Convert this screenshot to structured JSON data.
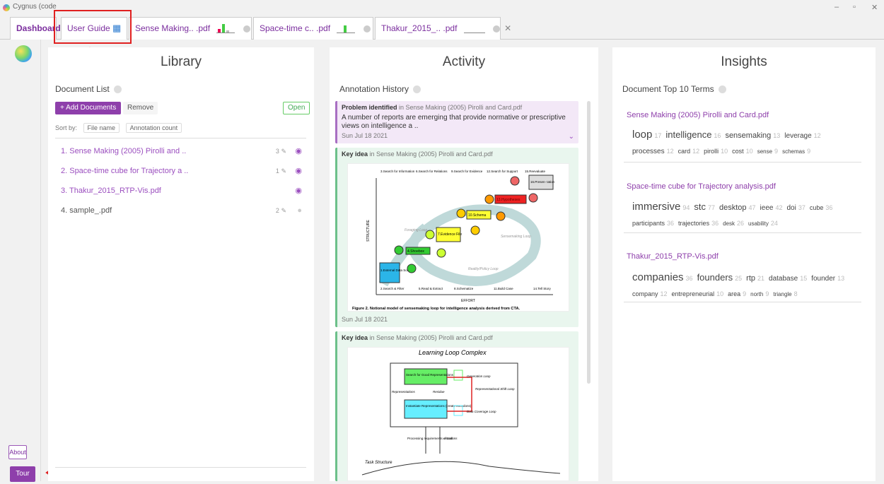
{
  "window": {
    "title": "Cygnus (code",
    "min": "–",
    "max": "▫",
    "close": "✕"
  },
  "tabs": [
    {
      "label": "Dashboard"
    },
    {
      "label": "User Guide"
    },
    {
      "label": "Sense Making.. .pdf"
    },
    {
      "label": "Space-time c.. .pdf"
    },
    {
      "label": "Thakur_2015_.. .pdf"
    }
  ],
  "tab_close": "✕",
  "sidebar": {
    "about": "About",
    "tour": "Tour"
  },
  "library": {
    "title": "Library",
    "section": "Document List",
    "add_button": "+ Add Documents",
    "remove_button": "Remove",
    "open_button": "Open",
    "sort_label": "Sort by:",
    "sort_options": [
      "File name",
      "Annotation count"
    ],
    "documents": [
      {
        "name": "1. Sense Making (2005) Pirolli and ..",
        "count": "3"
      },
      {
        "name": "2. Space-time cube for Trajectory a ..",
        "count": "1"
      },
      {
        "name": "3. Thakur_2015_RTP-Vis.pdf",
        "count": ""
      },
      {
        "name": "4. sample_.pdf",
        "count": "2"
      }
    ]
  },
  "activity": {
    "title": "Activity",
    "section": "Annotation History",
    "cards": [
      {
        "kind": "Problem identified",
        "in": "in Sense Making (2005) Pirolli and Card.pdf",
        "text": "A number of reports are emerging that provide normative or prescriptive views on intelligence a ..",
        "date": "Sun Jul 18 2021"
      },
      {
        "kind": "Key idea",
        "in": "in Sense Making (2005) Pirolli and Card.pdf",
        "caption": "Figure 2.  Notional model of sensemaking loop for intelligence analysis derived from CTA.",
        "date": "Sun Jul 18 2021"
      },
      {
        "kind": "Key idea",
        "in": "in Sense Making (2005) Pirolli and Card.pdf",
        "fig_title": "Learning Loop Complex"
      }
    ],
    "fig1": {
      "effort": "EFFORT",
      "structure": "STRUCTURE",
      "boxes": [
        "1.External Data Sources",
        "4.Shoebox",
        "7.Evidence File",
        "10.Schema",
        "13.Hypotheses",
        "16.Presen- tation"
      ],
      "steps": [
        "3.Search for Information",
        "6.Search for Relations",
        "9.Search for Evidence",
        "12.Search for Support",
        "15.Reevaluate"
      ],
      "bottom": [
        "2.Search & Filter",
        "5.Read & Extract",
        "8.Schematize",
        "11.Build Case",
        "14.Tell Story"
      ],
      "loops": [
        "Foraging Loop",
        "Sensemaking Loop",
        "Reality/Policy Loop"
      ]
    },
    "fig2": {
      "box1": "Search for Good Representations",
      "box2": "Instantiate Representations (create encodons)",
      "l1": "Generation Loop",
      "l2": "Representational Shift Loop",
      "l3": "Data Coverage Loop",
      "l4": "Representations",
      "l5": "Residue",
      "l6": "Processing requirements of task",
      "l7": "encodons",
      "l8": "Task Structure"
    }
  },
  "insights": {
    "title": "Insights",
    "section": "Document Top 10 Terms",
    "docs": [
      {
        "name": "Sense Making (2005) Pirolli and Card.pdf",
        "terms": [
          [
            "loop",
            "17"
          ],
          [
            "intelligence",
            "16"
          ],
          [
            "sensemaking",
            "13"
          ],
          [
            "leverage",
            "12"
          ],
          [
            "processes",
            "12"
          ],
          [
            "card",
            "12"
          ],
          [
            "pirolli",
            "10"
          ],
          [
            "cost",
            "10"
          ],
          [
            "sense",
            "9"
          ],
          [
            "schemas",
            "9"
          ]
        ]
      },
      {
        "name": "Space-time cube for Trajectory analysis.pdf",
        "terms": [
          [
            "immersive",
            "94"
          ],
          [
            "stc",
            "77"
          ],
          [
            "desktop",
            "47"
          ],
          [
            "ieee",
            "42"
          ],
          [
            "doi",
            "37"
          ],
          [
            "cube",
            "36"
          ],
          [
            "participants",
            "36"
          ],
          [
            "trajectories",
            "36"
          ],
          [
            "desk",
            "26"
          ],
          [
            "usability",
            "24"
          ]
        ]
      },
      {
        "name": "Thakur_2015_RTP-Vis.pdf",
        "terms": [
          [
            "companies",
            "36"
          ],
          [
            "founders",
            "25"
          ],
          [
            "rtp",
            "21"
          ],
          [
            "database",
            "15"
          ],
          [
            "founder",
            "13"
          ],
          [
            "company",
            "12"
          ],
          [
            "entrepreneurial",
            "10"
          ],
          [
            "area",
            "9"
          ],
          [
            "north",
            "9"
          ],
          [
            "triangle",
            "8"
          ]
        ]
      }
    ]
  }
}
